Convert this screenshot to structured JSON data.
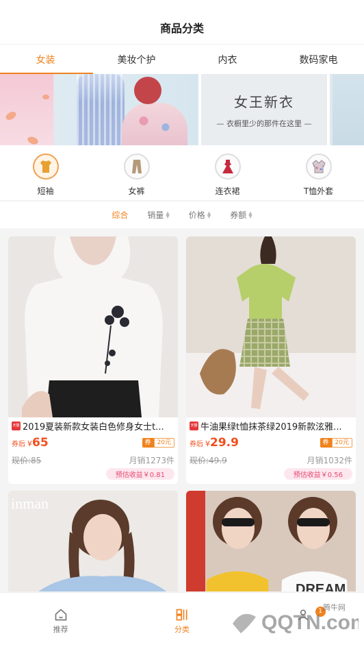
{
  "header": {
    "title": "商品分类"
  },
  "tabs": [
    {
      "label": "女装",
      "active": true
    },
    {
      "label": "美妆个护",
      "active": false
    },
    {
      "label": "内衣",
      "active": false
    },
    {
      "label": "数码家电",
      "active": false
    }
  ],
  "banner": {
    "title": "女王新衣",
    "subtitle": "— 衣橱里少的那件在这里 —"
  },
  "subcategories": [
    {
      "label": "短袖",
      "icon": "tshirt-icon",
      "color": "#e8a030"
    },
    {
      "label": "女裤",
      "icon": "pants-icon",
      "color": "#b59a7a"
    },
    {
      "label": "连衣裙",
      "icon": "dress-icon",
      "color": "#c8283c"
    },
    {
      "label": "T恤外套",
      "icon": "jacket-icon",
      "color": "#9a8a98"
    }
  ],
  "sort": [
    {
      "label": "综合",
      "active": true
    },
    {
      "label": "销量",
      "active": false
    },
    {
      "label": "价格",
      "active": false
    },
    {
      "label": "券额",
      "active": false
    }
  ],
  "products": [
    {
      "title": "2019夏装新款女装白色修身女士t...",
      "store_badge": "天猫",
      "price_prefix": "券后",
      "currency": "¥",
      "price": "65",
      "coupon_label": "券",
      "coupon_amount": "20元",
      "original": "现价:85",
      "sales": "月销1273件",
      "earnings": "预估收益￥0.81"
    },
    {
      "title": "牛油果绿t恤抹茶绿2019新款泫雅...",
      "store_badge": "天猫",
      "price_prefix": "券后",
      "currency": "¥",
      "price": "29.9",
      "coupon_label": "券",
      "coupon_amount": "20元",
      "original": "现价:49.9",
      "sales": "月销1032件",
      "earnings": "预估收益￥0.56"
    },
    {
      "title": "",
      "image_text": "inman"
    },
    {
      "title": "",
      "image_text": "DREAM"
    }
  ],
  "tabbar": [
    {
      "label": "推荐",
      "icon": "home-icon",
      "active": false
    },
    {
      "label": "分类",
      "icon": "category-icon",
      "active": true
    },
    {
      "label": "",
      "icon": "user-icon",
      "active": false,
      "badge": "1"
    }
  ],
  "watermark": {
    "text": "腾牛网",
    "brand": "QQTN.com"
  },
  "colors": {
    "accent": "#f0821e",
    "price": "#f24e1e",
    "earn_bg": "#fde7ee"
  }
}
